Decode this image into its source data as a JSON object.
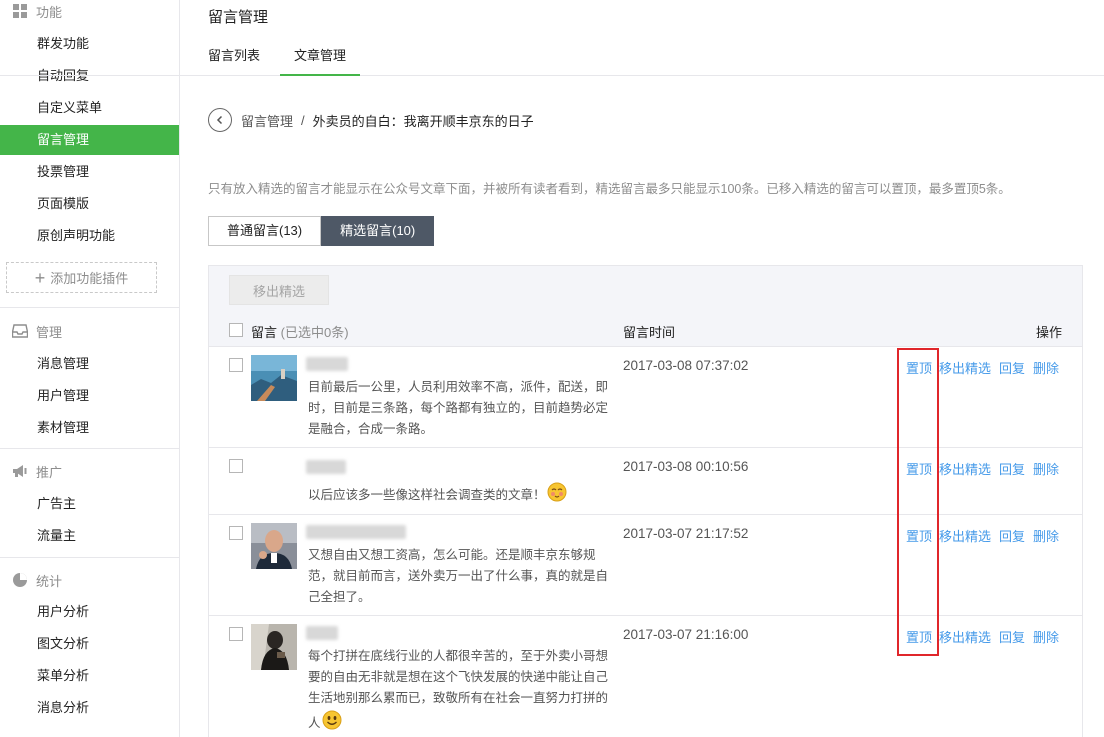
{
  "sidebar": {
    "sections": [
      {
        "title": "功能",
        "icon": "grid-icon",
        "items": [
          "群发功能",
          "自动回复",
          "自定义菜单",
          "留言管理",
          "投票管理",
          "页面模版",
          "原创声明功能"
        ]
      },
      {
        "title": "管理",
        "icon": "inbox-icon",
        "items": [
          "消息管理",
          "用户管理",
          "素材管理"
        ]
      },
      {
        "title": "推广",
        "icon": "megaphone-icon",
        "items": [
          "广告主",
          "流量主"
        ]
      },
      {
        "title": "统计",
        "icon": "pie-chart-icon",
        "items": [
          "用户分析",
          "图文分析",
          "菜单分析",
          "消息分析"
        ]
      }
    ],
    "add_plugin": "添加功能插件",
    "active_item": "留言管理"
  },
  "header": {
    "title": "留言管理",
    "tabs": [
      "留言列表",
      "文章管理"
    ],
    "active_tab": "文章管理"
  },
  "breadcrumb": {
    "parent": "留言管理",
    "separator": "/",
    "current": "外卖员的自白：我离开顺丰京东的日子"
  },
  "tip": "只有放入精选的留言才能显示在公众号文章下面，并被所有读者看到，精选留言最多只能显示100条。已移入精选的留言可以置顶，最多置顶5条。",
  "segments": [
    "普通留言(13)",
    "精选留言(10)"
  ],
  "active_segment": "精选留言(10)",
  "toolbar": {
    "move_button": "移出精选"
  },
  "table": {
    "col_message": "留言",
    "col_message_sub": "(已选中0条)",
    "col_time": "留言时间",
    "col_ops": "操作",
    "ops": [
      "置顶",
      "移出精选",
      "回复",
      "删除"
    ],
    "rows": [
      {
        "content": "目前最后一公里，人员利用效率不高，派件，配送，即时，目前是三条路，每个路都有独立的，目前趋势必定是融合，合成一条路。",
        "time": "2017-03-08 07:37:02",
        "avatar": "city-photo-avatar"
      },
      {
        "content": "以后应该多一些像这样社会调查类的文章！",
        "time": "2017-03-08 00:10:56",
        "avatar": "",
        "emoji": "blush-emoji"
      },
      {
        "content": "又想自由又想工资高，怎么可能。还是顺丰京东够规范，就目前而言，送外卖万一出了什么事，真的就是自己全担了。",
        "time": "2017-03-07 21:17:52",
        "avatar": "person-photo-avatar"
      },
      {
        "content": "每个打拼在底线行业的人都很辛苦的，至于外卖小哥想要的自由无非就是想在这个飞快发展的快递中能让自己生活地别那么累而已，致敬所有在社会一直努力打拼的人",
        "time": "2017-03-07 21:16:00",
        "avatar": "dark-photo-avatar",
        "emoji": "smile-emoji"
      }
    ]
  },
  "colors": {
    "brand_green": "#44b549",
    "link_blue": "#459ae9",
    "highlight_red": "#e0262b",
    "segment_active": "#4e5866"
  }
}
